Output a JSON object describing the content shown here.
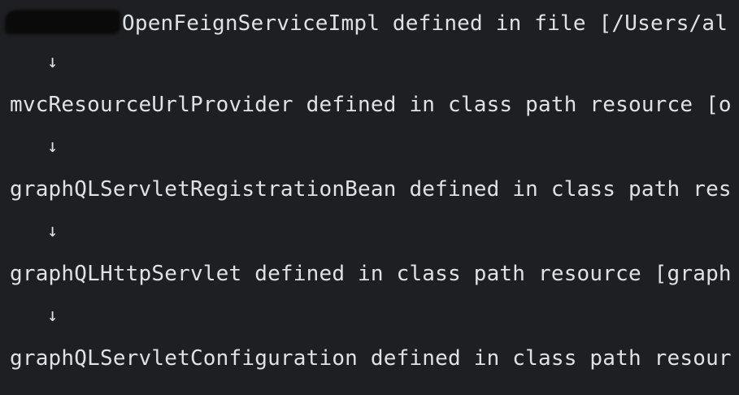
{
  "console": {
    "lines": [
      "OpenFeignServiceImpl defined in file [/Users/al",
      "mvcResourceUrlProvider defined in class path resource [o",
      "graphQLServletRegistrationBean defined in class path res",
      "graphQLHttpServlet defined in class path resource [graph",
      "graphQLServletConfiguration defined in class path resour"
    ],
    "arrow": "↓"
  }
}
